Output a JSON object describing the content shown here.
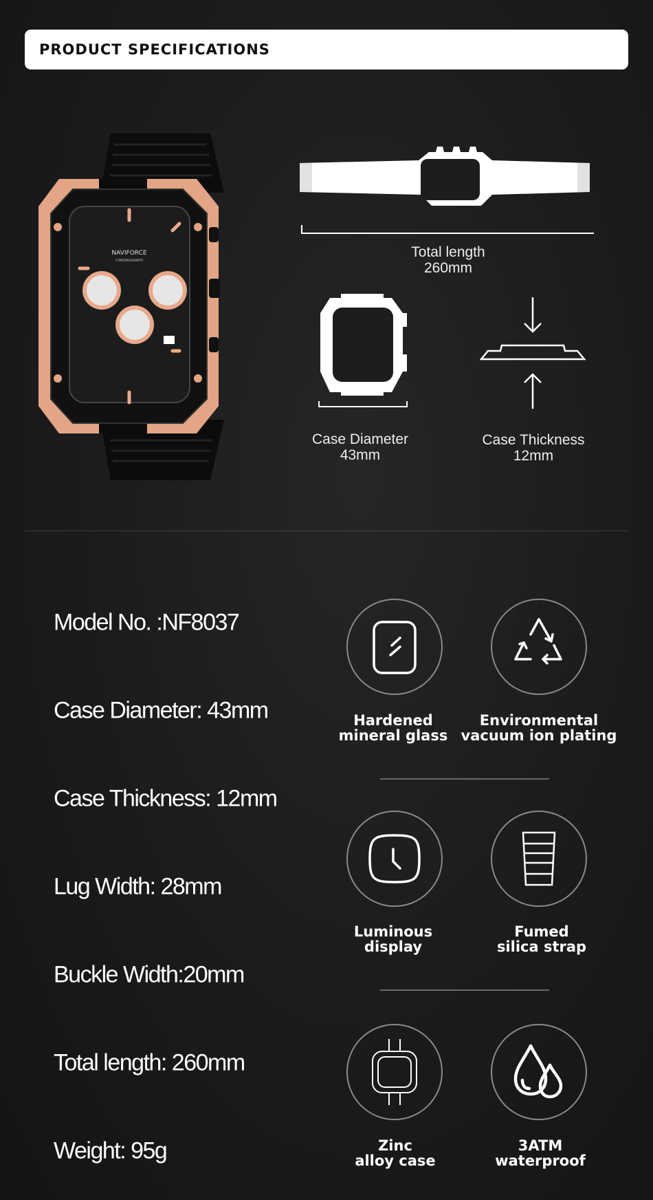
{
  "header": {
    "title": "PRODUCT SPECIFICATIONS"
  },
  "watch": {
    "brand": "NAVIFORCE",
    "subtitle": "CHRONOGRAPH",
    "accent_color": "#e8a98a"
  },
  "diagrams": {
    "total_length": {
      "label": "Total length",
      "value": "260mm"
    },
    "case_diameter": {
      "label": "Case Diameter",
      "value": "43mm"
    },
    "case_thickness": {
      "label": "Case Thickness",
      "value": "12mm"
    }
  },
  "specs": [
    "Model No. :NF8037",
    "Case Diameter: 43mm",
    "Case Thickness: 12mm",
    "Lug Width: 28mm",
    "Buckle Width:20mm",
    "Total length: 260mm",
    "Weight: 95g"
  ],
  "features": [
    {
      "icon": "glass-icon",
      "line1": "Hardened",
      "line2": "mineral glass"
    },
    {
      "icon": "recycle-icon",
      "line1": "Environmental",
      "line2": "vacuum ion plating"
    },
    {
      "icon": "luminous-clock-icon",
      "line1": "Luminous",
      "line2": "display"
    },
    {
      "icon": "strap-icon",
      "line1": "Fumed",
      "line2": "silica strap"
    },
    {
      "icon": "case-icon",
      "line1": "Zinc",
      "line2": "alloy case"
    },
    {
      "icon": "water-drops-icon",
      "line1": "3ATM",
      "line2": "waterproof"
    }
  ]
}
